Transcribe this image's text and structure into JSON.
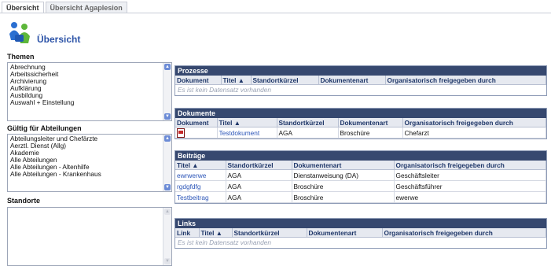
{
  "tabs": [
    {
      "label": "Übersicht",
      "active": true
    },
    {
      "label": "Übersicht Agaplesion",
      "active": false
    }
  ],
  "page": {
    "title": "Übersicht",
    "logo_icon": "puzzle-people-icon"
  },
  "sidebar": {
    "themen": {
      "label": "Themen",
      "items": [
        "Abrechnung",
        "Arbeitssicherheit",
        "Archivierung",
        "Aufklärung",
        "Ausbildung",
        "Auswahl + Einstellung"
      ]
    },
    "abteilungen": {
      "label": "Gültig für Abteilungen",
      "items": [
        "Abteilungsleiter und Chefärzte",
        "Aerztl. Dienst (Allg)",
        "Akademie",
        "Alle Abteilungen",
        "Alle Abteilungen - Altenhilfe",
        "Alle Abteilungen - Krankenhaus"
      ]
    },
    "standorte": {
      "label": "Standorte",
      "items": []
    }
  },
  "prozesse": {
    "title": "Prozesse",
    "columns": [
      "Dokument",
      "Titel ▲",
      "Standortkürzel",
      "Dokumentenart",
      "Organisatorisch freigegeben durch"
    ],
    "empty": "Es ist kein Datensatz vorhanden"
  },
  "dokumente": {
    "title": "Dokumente",
    "columns": [
      "Dokument",
      "Titel ▲",
      "Standortkürzel",
      "Dokumentenart",
      "Organisatorisch freigegeben durch"
    ],
    "rows": [
      {
        "icon": "pdf-icon",
        "title": "Testdokument",
        "standort": "AGA",
        "art": "Broschüre",
        "freigabe": "Chefarzt"
      }
    ]
  },
  "beitraege": {
    "title": "Beiträge",
    "columns": [
      "Titel ▲",
      "Standortkürzel",
      "Dokumentenart",
      "Organisatorisch freigegeben durch"
    ],
    "rows": [
      {
        "title": "ewrwerwe",
        "standort": "AGA",
        "art": "Dienstanweisung (DA)",
        "freigabe": "Geschäftsleiter"
      },
      {
        "title": "rgdgfdfg",
        "standort": "AGA",
        "art": "Broschüre",
        "freigabe": "Geschäftsführer"
      },
      {
        "title": "Testbeitrag",
        "standort": "AGA",
        "art": "Broschüre",
        "freigabe": "ewerwe"
      }
    ]
  },
  "links": {
    "title": "Links",
    "columns": [
      "Link",
      "Titel ▲",
      "Standortkürzel",
      "Dokumentenart",
      "Organisatorisch freigegeben durch"
    ],
    "empty": "Es ist kein Datensatz vorhanden"
  }
}
